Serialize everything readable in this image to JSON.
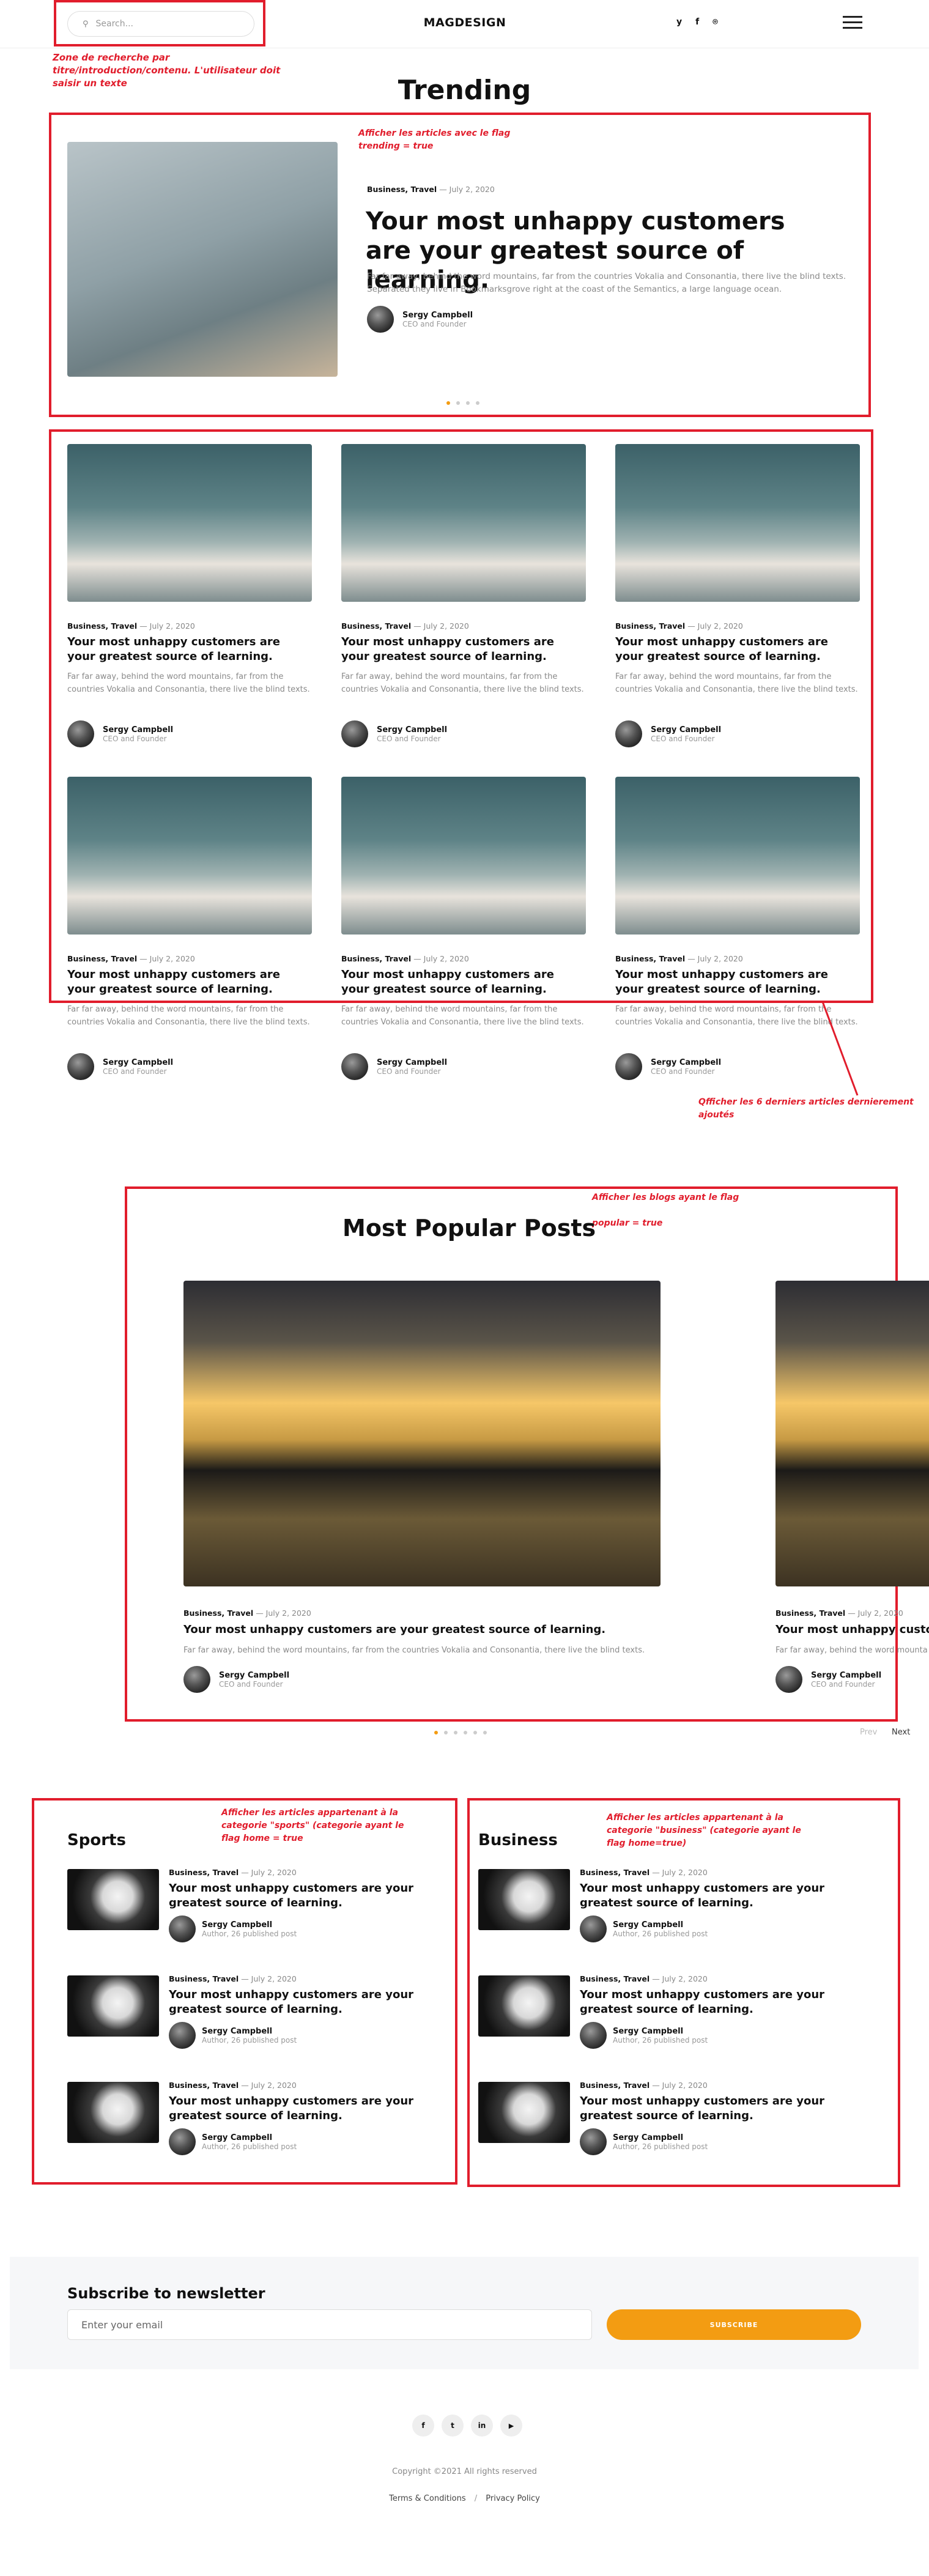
{
  "header": {
    "search_placeholder": "Search...",
    "logo": "MAGDESIGN",
    "social": [
      "y",
      "f",
      "⌾"
    ]
  },
  "notes": {
    "search": "Zone de recherche par titre/introduction/contenu. L'utilisateur doit saisir un texte",
    "trending": "Afficher les articles avec le flag trending = true",
    "latest": "Qfficher les 6 derniers articles dernierement ajoutés",
    "popular_1": "Afficher les blogs ayant le flag",
    "popular_2": "popular = true",
    "sports": "Afficher les articles appartenant à la categorie \"sports\" (categorie ayant le flag home = true",
    "business": "Afficher les articles appartenant à la categorie \"business\" (categorie ayant le flag home=true)"
  },
  "trending": {
    "title": "Trending",
    "category1": "Business",
    "category2": "Travel",
    "date": "— July 2, 2020",
    "headline": "Your most unhappy customers are your greatest source of learning.",
    "excerpt": "Far far away, behind the word mountains, far from the countries Vokalia and Consonantia, there live the blind texts. Separated they live in Bookmarksgrove right at the coast of the Semantics, a large language ocean.",
    "author": "Sergy Campbell",
    "role": "CEO and Founder"
  },
  "grid_card": {
    "category1": "Business",
    "category2": "Travel",
    "date": "— July 2, 2020",
    "headline": "Your most unhappy customers are your greatest source of learning.",
    "excerpt": "Far far away, behind the word mountains, far from the countries Vokalia and Consonantia, there live the blind texts.",
    "author": "Sergy Campbell",
    "role": "CEO and Founder"
  },
  "popular": {
    "title": "Most Popular Posts",
    "category1": "Business",
    "category2": "Travel",
    "date": "— July 2, 2020",
    "headline": "Your most unhappy customers are your greatest source of learning.",
    "excerpt": "Far far away, behind the word mountains, far from the countries Vokalia and Consonantia, there live the blind texts.",
    "excerpt_cut": "Far far away, behind the word mounta",
    "author": "Sergy Campbell",
    "role": "CEO and Founder",
    "prev": "Prev",
    "next": "Next"
  },
  "sports": {
    "title": "Sports"
  },
  "business": {
    "title": "Business"
  },
  "list_card": {
    "category1": "Business",
    "category2": "Travel",
    "date": "— July 2, 2020",
    "headline": "Your most unhappy customers are your greatest source of learning.",
    "author": "Sergy Campbell",
    "role": "Author, 26 published post"
  },
  "newsletter": {
    "title": "Subscribe to newsletter",
    "placeholder": "Enter your email",
    "button": "SUBSCRIBE"
  },
  "footer": {
    "social": [
      "f",
      "t",
      "in",
      "▶"
    ],
    "copyright": "Copyright ©2021 All rights reserved",
    "terms": "Terms & Conditions",
    "separator": "/",
    "privacy": "Privacy Policy"
  },
  "colors": {
    "annotation": "#e11d2c",
    "accent": "#f39c12"
  }
}
